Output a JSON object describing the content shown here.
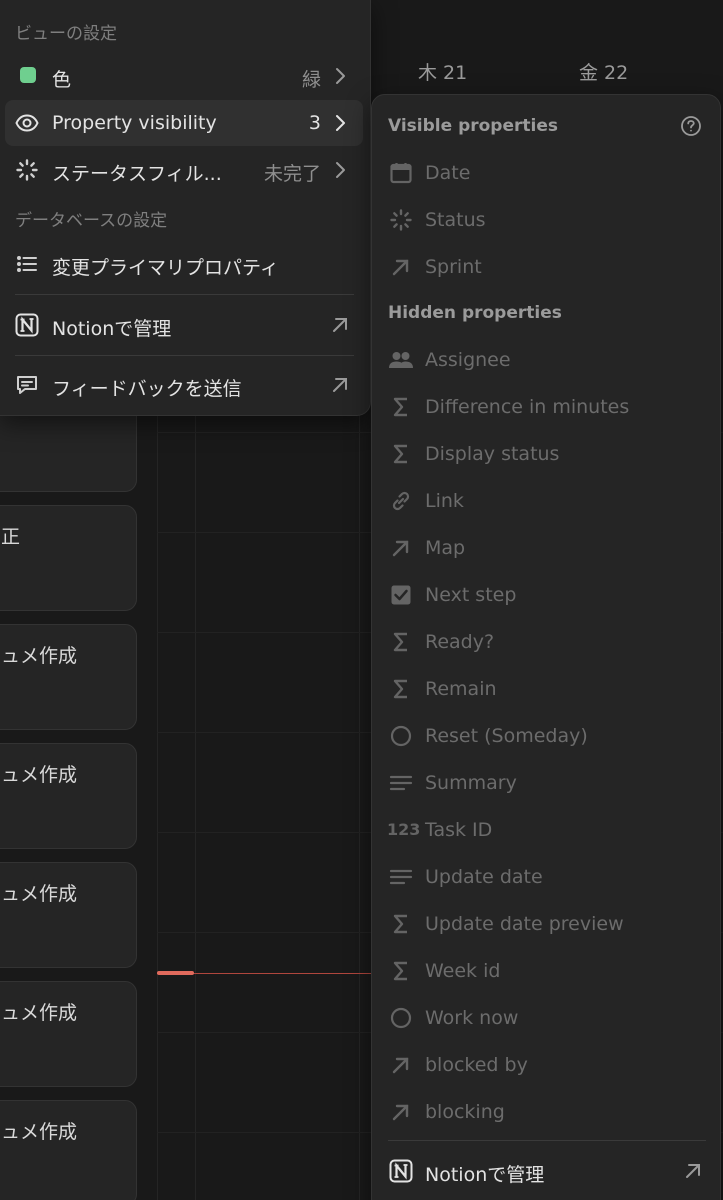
{
  "calendar": {
    "days": [
      "木 21",
      "金 22"
    ],
    "task_cards": [
      "正",
      "ュメ作成",
      "ュメ作成",
      "ュメ作成",
      "ュメ作成",
      "ュメ作成"
    ]
  },
  "menu": {
    "view_section": "ビューの設定",
    "color": {
      "label": "色",
      "value": "緑",
      "swatch": "#6fcf8f"
    },
    "property_visibility": {
      "label": "Property visibility",
      "value": "3"
    },
    "status_filter": {
      "label": "ステータスフィル...",
      "value": "未完了"
    },
    "db_section": "データベースの設定",
    "primary_property": {
      "label": "変更プライマリプロパティ"
    },
    "manage_notion": {
      "label": "Notionで管理"
    },
    "feedback": {
      "label": "フィードバックを送信"
    }
  },
  "panel": {
    "visible_label": "Visible properties",
    "visible": [
      {
        "name": "Date",
        "icon": "calendar-icon"
      },
      {
        "name": "Status",
        "icon": "status-spinner-icon"
      },
      {
        "name": "Sprint",
        "icon": "relation-arrow-icon"
      }
    ],
    "hidden_label": "Hidden properties",
    "hidden": [
      {
        "name": "Assignee",
        "icon": "people-icon"
      },
      {
        "name": "Difference in minutes",
        "icon": "formula-sigma-icon"
      },
      {
        "name": "Display status",
        "icon": "formula-sigma-icon"
      },
      {
        "name": "Link",
        "icon": "link-icon"
      },
      {
        "name": "Map",
        "icon": "relation-arrow-icon"
      },
      {
        "name": "Next step",
        "icon": "checkbox-icon"
      },
      {
        "name": "Ready?",
        "icon": "formula-sigma-icon"
      },
      {
        "name": "Remain",
        "icon": "formula-sigma-icon"
      },
      {
        "name": "Reset (Someday)",
        "icon": "circle-icon"
      },
      {
        "name": "Summary",
        "icon": "text-lines-icon"
      },
      {
        "name": "Task ID",
        "icon": "number-123-icon",
        "icon_text": "123"
      },
      {
        "name": "Update date",
        "icon": "text-lines-icon"
      },
      {
        "name": "Update date preview",
        "icon": "formula-sigma-icon"
      },
      {
        "name": "Week id",
        "icon": "formula-sigma-icon"
      },
      {
        "name": "Work now",
        "icon": "circle-icon"
      },
      {
        "name": "blocked by",
        "icon": "relation-arrow-icon"
      },
      {
        "name": "blocking",
        "icon": "relation-arrow-icon"
      }
    ],
    "footer": {
      "label": "Notionで管理"
    }
  }
}
